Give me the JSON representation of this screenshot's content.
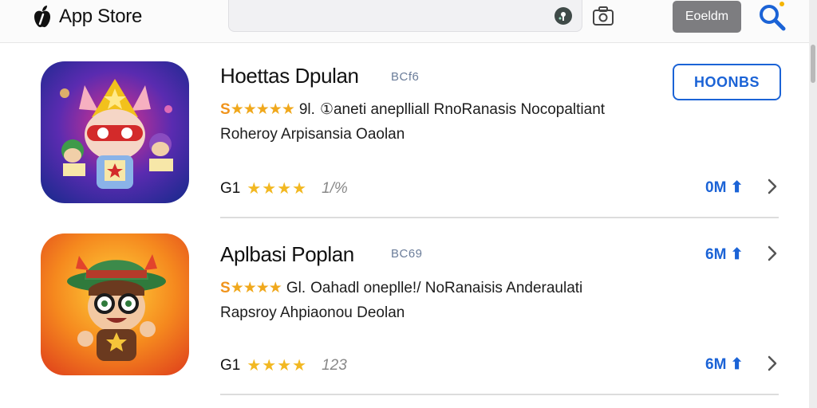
{
  "header": {
    "title": "App Store",
    "search_placeholder": "",
    "button_label": "Eoeldm"
  },
  "apps": [
    {
      "name": "Hoettas Dpulan",
      "tag": "BCf6",
      "meta_prefix": "S",
      "meta_stars": "★★★★★",
      "meta_suffix": "9l.",
      "meta_desc": "①aneti aneplliall RnoRanasis Nocopaltiant",
      "subtitle": "Roheroy Arpisansia Oaolan",
      "rating": "G1",
      "rating_stars": "★★★★",
      "rating_count": "1/%",
      "size": "0M ⬆",
      "action_label": "HOONBS"
    },
    {
      "name": "Aplbasi Poplan",
      "tag": "BC69",
      "meta_prefix": "S",
      "meta_stars": "★★★★",
      "meta_suffix": "Gl.",
      "meta_desc": "Oahadl oneplle!/ NoRanaisis Anderaulati",
      "subtitle": "Rapsroy Ahpiaonou Deolan",
      "rating": "G1",
      "rating_stars": "★★★★",
      "rating_count": "123",
      "size": "6M ⬆"
    }
  ],
  "colors": {
    "accent": "#1b63d6",
    "star": "#f2b822",
    "meta_orange": "#f0941c"
  }
}
